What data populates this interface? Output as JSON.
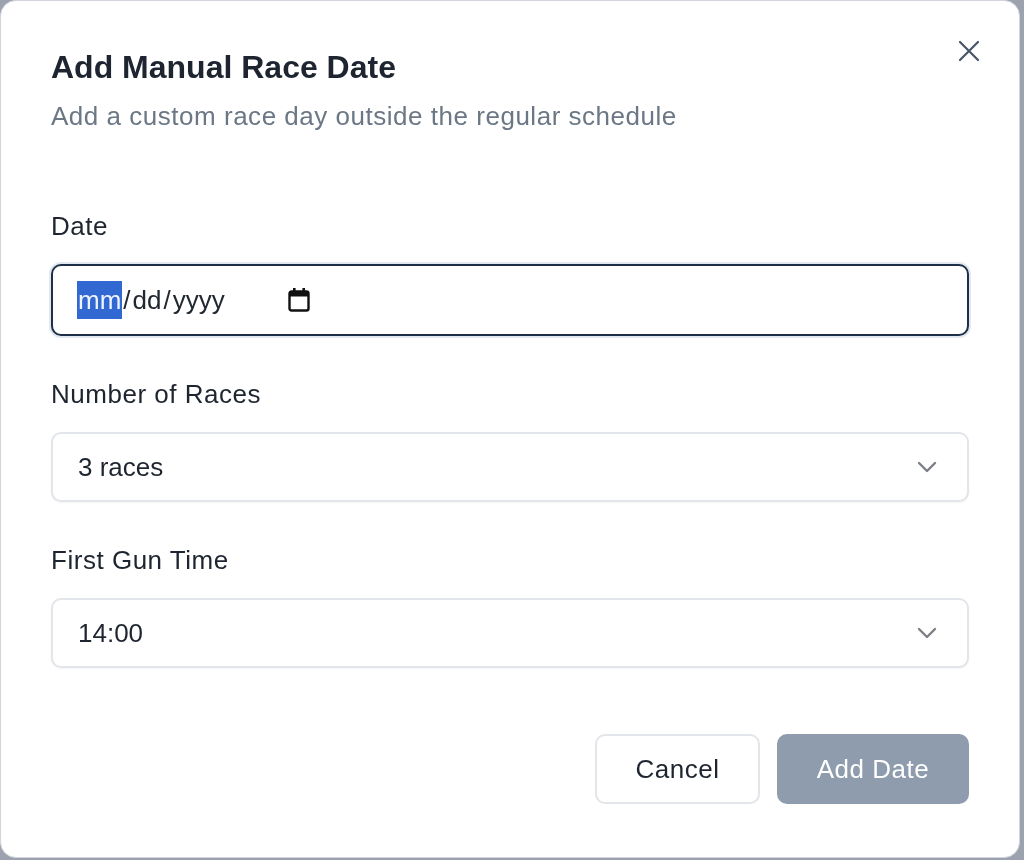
{
  "dialog": {
    "title": "Add Manual Race Date",
    "subtitle": "Add a custom race day outside the regular schedule"
  },
  "fields": [
    {
      "kind": "date",
      "label": "Date",
      "focused": true,
      "segments": [
        {
          "text": "mm",
          "selected": true
        },
        {
          "text": "/",
          "selected": false
        },
        {
          "text": "dd",
          "selected": false
        },
        {
          "text": "/",
          "selected": false
        },
        {
          "text": "yyyy",
          "selected": false
        }
      ]
    },
    {
      "kind": "select",
      "label": "Number of Races",
      "focused": false,
      "value": "3 races"
    },
    {
      "kind": "select",
      "label": "First Gun Time",
      "focused": false,
      "value": "14:00"
    }
  ],
  "buttons": [
    {
      "kind": "secondary",
      "label": "Cancel",
      "disabled": false
    },
    {
      "kind": "primary",
      "label": "Add Date",
      "disabled": true
    }
  ]
}
